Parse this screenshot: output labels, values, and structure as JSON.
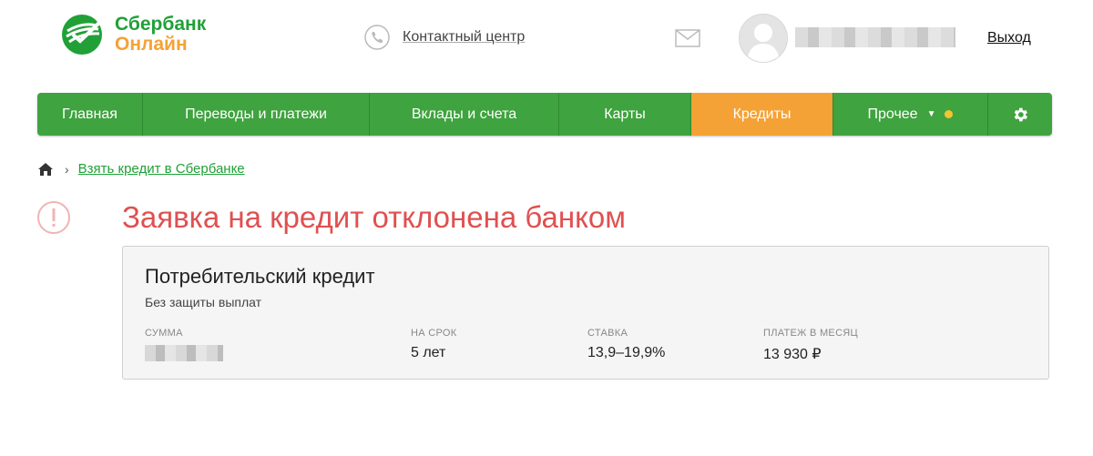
{
  "header": {
    "logo_line1": "Сбербанк",
    "logo_line2": "Онлайн",
    "contact_label": "Контактный центр",
    "logout_label": "Выход"
  },
  "nav": {
    "items": [
      {
        "label": "Главная"
      },
      {
        "label": "Переводы и платежи"
      },
      {
        "label": "Вклады и счета"
      },
      {
        "label": "Карты"
      },
      {
        "label": "Кредиты"
      },
      {
        "label": "Прочее"
      }
    ],
    "active_index": 4
  },
  "breadcrumb": {
    "separator": "›",
    "link_label": "Взять кредит в Сбербанке"
  },
  "alert": {
    "title": "Заявка на кредит отклонена банком"
  },
  "loan": {
    "title": "Потребительский кредит",
    "subtitle": "Без защиты выплат",
    "columns": [
      {
        "label": "Сумма",
        "value": ""
      },
      {
        "label": "На срок",
        "value": "5 лет"
      },
      {
        "label": "Ставка",
        "value": "13,9–19,9%"
      },
      {
        "label": "Платеж в месяц",
        "value": "13 930 ₽"
      }
    ]
  },
  "colors": {
    "brand_green": "#21a038",
    "nav_green": "#3fa33f",
    "accent_orange": "#f4a236",
    "alert_red": "#e05050"
  },
  "icons": [
    "sberbank-logo-icon",
    "phone-icon",
    "mail-icon",
    "avatar-icon",
    "chevron-down-icon",
    "notification-dot-icon",
    "gear-icon",
    "home-icon",
    "warning-icon"
  ]
}
